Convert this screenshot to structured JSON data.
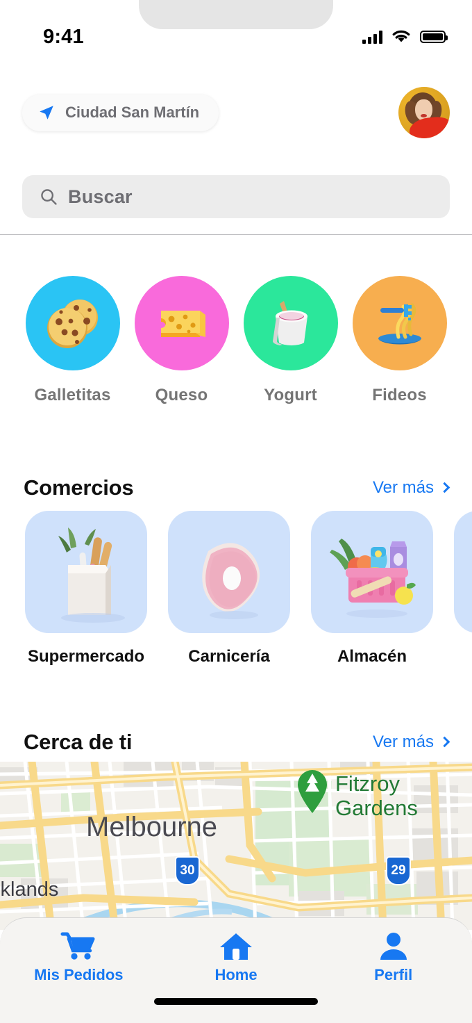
{
  "status_bar": {
    "time": "9:41",
    "signal_icon": "cellular-signal-icon",
    "wifi_icon": "wifi-icon",
    "battery_icon": "battery-full-icon"
  },
  "header": {
    "location_icon": "navigation-arrow-icon",
    "location_label": "Ciudad San Martín",
    "avatar_name": "user-avatar"
  },
  "search": {
    "placeholder": "Buscar",
    "icon": "search-icon"
  },
  "categories": [
    {
      "label": "Galletitas",
      "icon": "cookies-icon",
      "color": "#2AC4F4"
    },
    {
      "label": "Queso",
      "icon": "cheese-icon",
      "color": "#F96ADB"
    },
    {
      "label": "Yogurt",
      "icon": "yogurt-cup-icon",
      "color": "#2BE79B"
    },
    {
      "label": "Fideos",
      "icon": "noodles-icon",
      "color": "#F7AE4F"
    }
  ],
  "comercios": {
    "title": "Comercios",
    "see_more": "Ver más",
    "see_more_icon": "chevron-right-icon",
    "cards": [
      {
        "label": "Supermercado",
        "icon": "grocery-bag-icon"
      },
      {
        "label": "Carnicería",
        "icon": "steak-icon"
      },
      {
        "label": "Almacén",
        "icon": "shopping-basket-icon"
      },
      {
        "label": "",
        "icon": "partial-card-icon"
      }
    ]
  },
  "cerca_de_ti": {
    "title": "Cerca de ti",
    "see_more": "Ver más",
    "see_more_icon": "chevron-right-icon",
    "map": {
      "city_label": "Melbourne",
      "district_label": "cklands",
      "park_label_line1": "Fitzroy",
      "park_label_line2": "Gardens",
      "park_pin_icon": "park-tree-pin-icon",
      "route_shield_left": "30",
      "route_shield_right": "29"
    }
  },
  "tabbar": {
    "items": [
      {
        "label": "Mis Pedidos",
        "icon": "shopping-cart-icon"
      },
      {
        "label": "Home",
        "icon": "home-icon"
      },
      {
        "label": "Perfil",
        "icon": "person-icon"
      }
    ],
    "active": "Home",
    "accent_color": "#1778F2"
  },
  "colors": {
    "accent_blue": "#1778F2",
    "card_blue": "#CFE1FB",
    "search_gray": "#ECECEC",
    "label_gray": "#757575"
  }
}
